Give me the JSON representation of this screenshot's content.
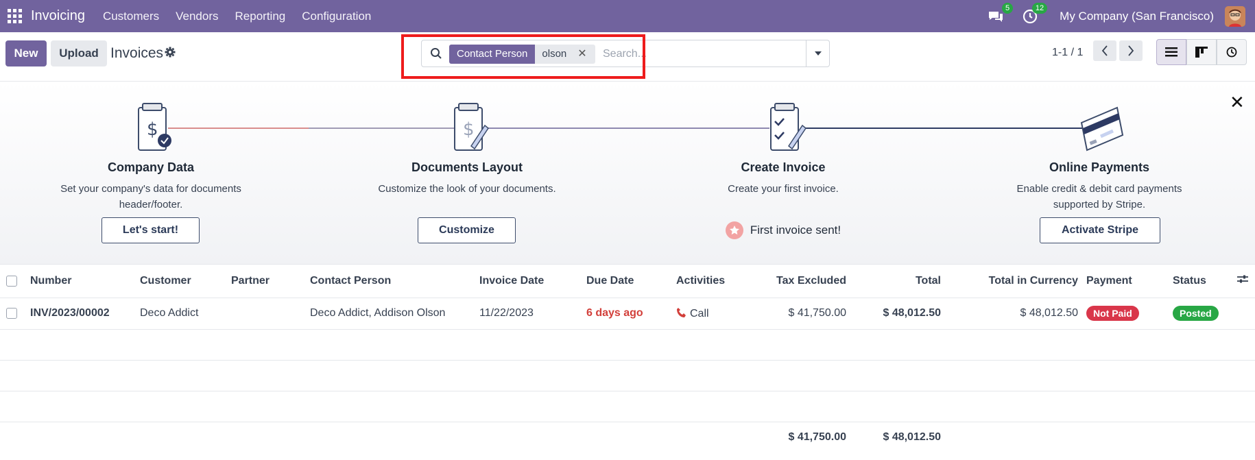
{
  "topbar": {
    "app_name": "Invoicing",
    "menu": [
      "Customers",
      "Vendors",
      "Reporting",
      "Configuration"
    ],
    "messages_count": "5",
    "activities_count": "12",
    "company": "My Company (San Francisco)"
  },
  "control": {
    "new_label": "New",
    "upload_label": "Upload",
    "title": "Invoices",
    "search": {
      "facet_label": "Contact Person",
      "facet_value": "olson",
      "placeholder": "Search..."
    },
    "pager": "1-1 / 1"
  },
  "onboarding": {
    "steps": [
      {
        "title": "Company Data",
        "desc": "Set your company's data for documents header/footer.",
        "button": "Let's start!"
      },
      {
        "title": "Documents Layout",
        "desc": "Customize the look of your documents.",
        "button": "Customize"
      },
      {
        "title": "Create Invoice",
        "desc": "Create your first invoice.",
        "done_text": "First invoice sent!"
      },
      {
        "title": "Online Payments",
        "desc": "Enable credit & debit card payments supported by Stripe.",
        "button": "Activate Stripe"
      }
    ]
  },
  "table": {
    "columns": [
      "Number",
      "Customer",
      "Partner",
      "Contact Person",
      "Invoice Date",
      "Due Date",
      "Activities",
      "Tax Excluded",
      "Total",
      "Total in Currency",
      "Payment",
      "Status"
    ],
    "rows": [
      {
        "number": "INV/2023/00002",
        "customer": "Deco Addict",
        "partner": "",
        "contact_person": "Deco Addict, Addison Olson",
        "invoice_date": "11/22/2023",
        "due_date": "6 days ago",
        "activity": "Call",
        "tax_excluded": "$ 41,750.00",
        "total": "$ 48,012.50",
        "total_currency": "$ 48,012.50",
        "payment": "Not Paid",
        "status": "Posted"
      }
    ],
    "totals": {
      "tax_excluded": "$ 41,750.00",
      "total": "$ 48,012.50"
    }
  },
  "colors": {
    "brand": "#71639e",
    "highlight": "#ee1c1c",
    "not_paid": "#d9364a",
    "posted": "#28a745",
    "overdue": "#d23f3a"
  }
}
